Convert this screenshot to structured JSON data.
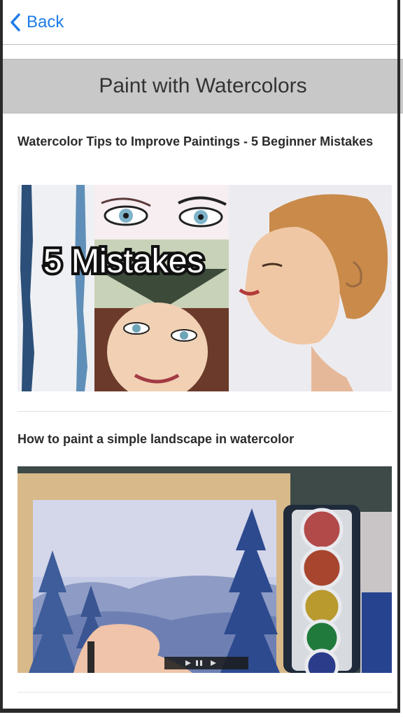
{
  "nav": {
    "back_label": "Back"
  },
  "header": {
    "title": "Paint with Watercolors"
  },
  "videos": [
    {
      "title": "Watercolor Tips to Improve Paintings - 5 Beginner Mistakes",
      "overlay_text": "5 Mistakes"
    },
    {
      "title": "How to paint a simple landscape in watercolor"
    }
  ],
  "colors": {
    "accent": "#1e7ce8",
    "header_bg": "#c8c8c8"
  }
}
